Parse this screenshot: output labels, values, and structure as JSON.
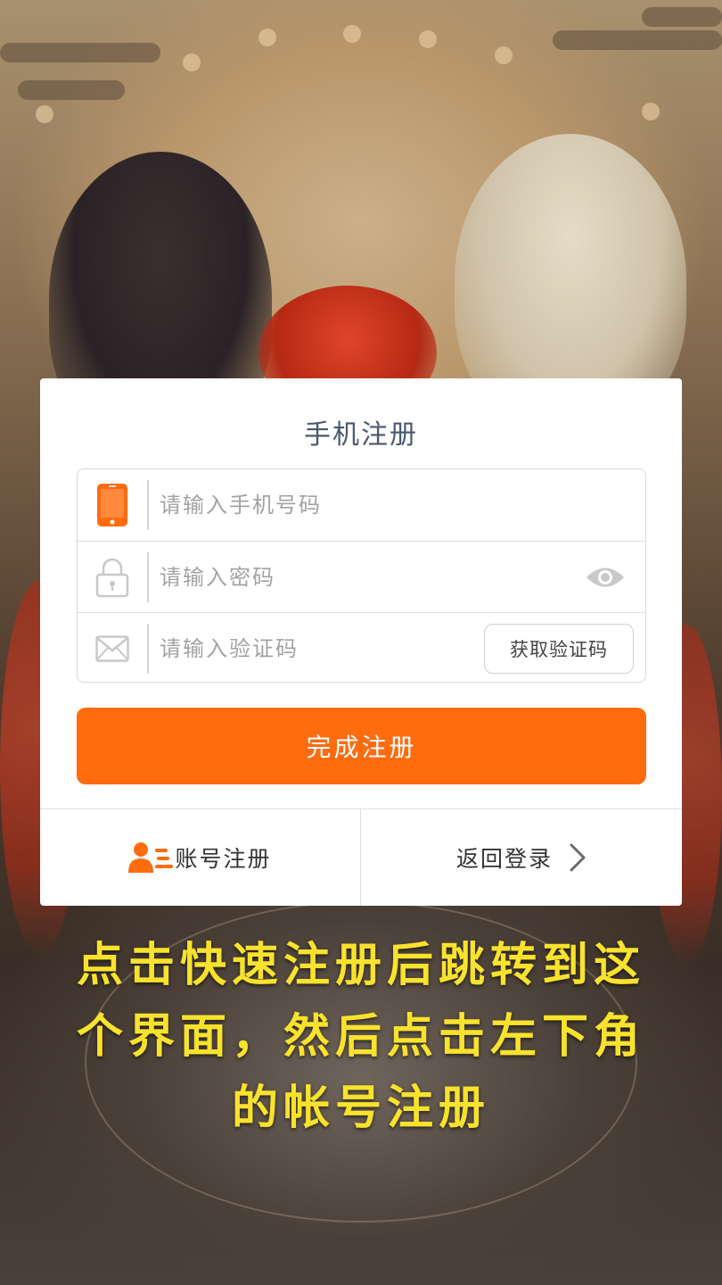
{
  "dialog": {
    "title": "手机注册",
    "phone": {
      "placeholder": "请输入手机号码",
      "icon": "smartphone-icon"
    },
    "password": {
      "placeholder": "请输入密码",
      "icon": "lock-icon",
      "toggle_icon": "eye-icon"
    },
    "code": {
      "placeholder": "请输入验证码",
      "icon": "envelope-icon",
      "get_code_label": "获取验证码"
    },
    "submit_label": "完成注册",
    "footer": {
      "account_register_label": "账号注册",
      "account_register_icon": "user-list-icon",
      "back_login_label": "返回登录",
      "back_login_icon": "chevron-right-icon"
    }
  },
  "caption": {
    "line1": "点击快速注册后跳转到这",
    "line2": "个界面，然后点击左下角",
    "line3": "的帐号注册"
  },
  "colors": {
    "accent": "#ff6b0f",
    "caption": "#f9e22c",
    "title": "#4a5870"
  }
}
